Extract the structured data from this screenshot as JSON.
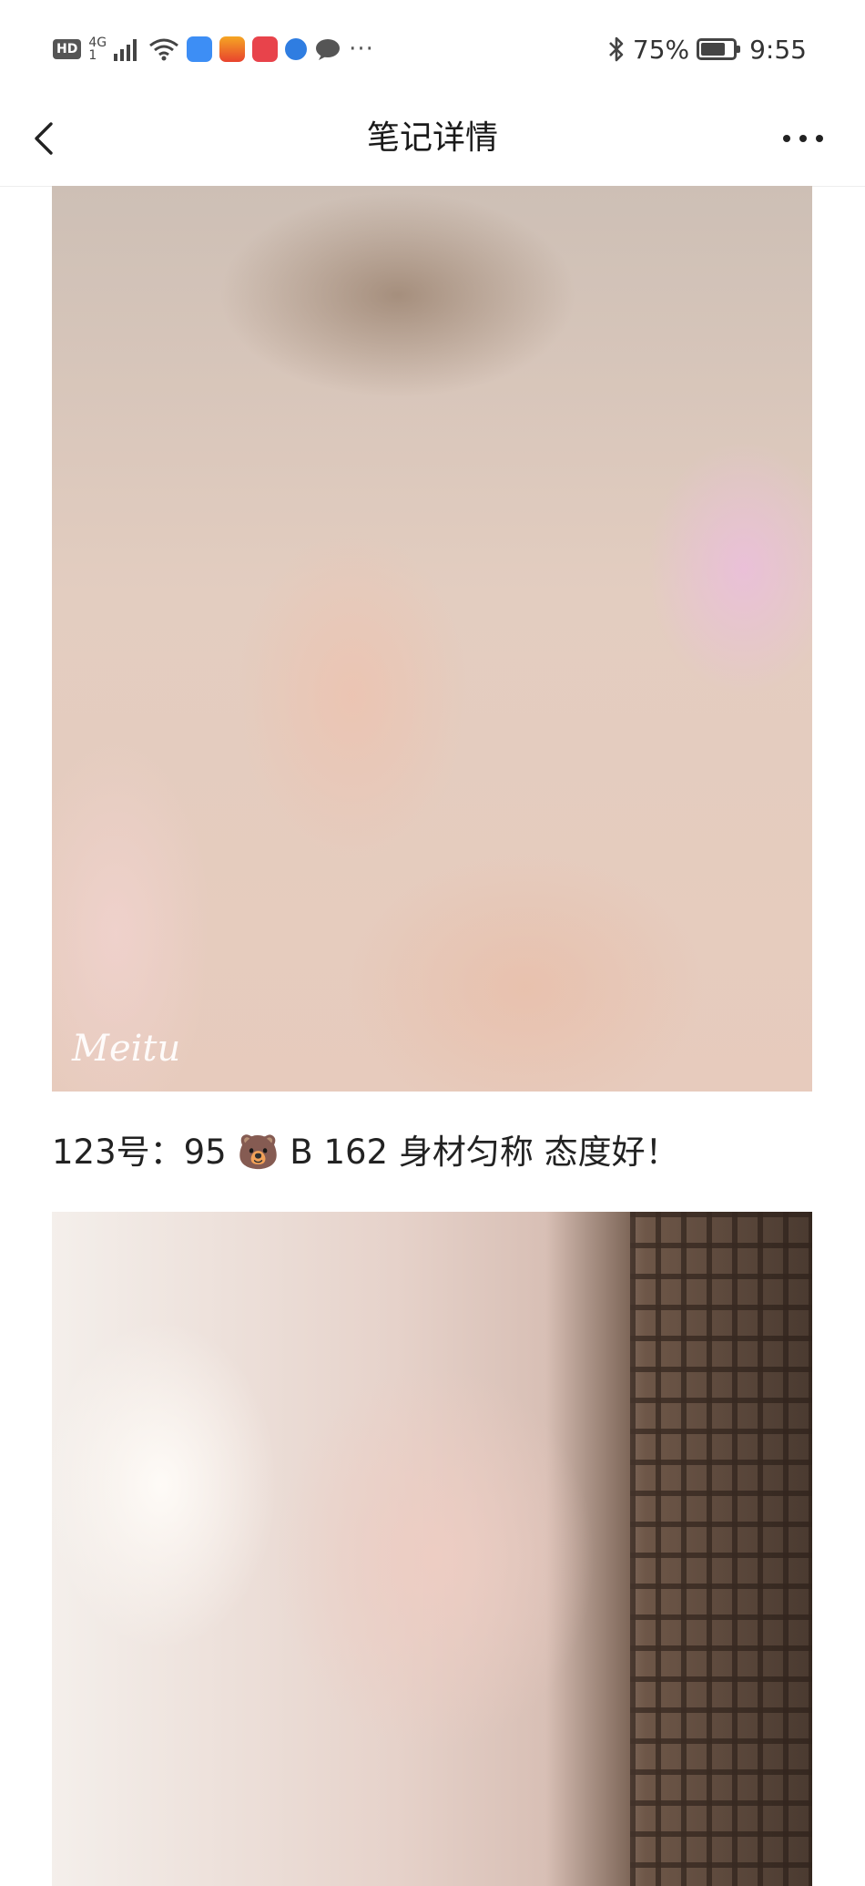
{
  "status_bar": {
    "hd": "HD",
    "network": "4G",
    "network_sub": "1",
    "more": "···",
    "battery_percent": "75%",
    "battery_level": 0.75,
    "time": "9:55",
    "icons": [
      "signal-icon",
      "wifi-icon",
      "bluetooth-icon"
    ]
  },
  "header": {
    "title": "笔记详情",
    "back_icon": "chevron-left-icon",
    "more_icon": "more-horizontal-icon"
  },
  "content": {
    "photo_1_watermark": "Meitu",
    "caption": "123号：95 🐻 B   162    身材匀称    态度好！"
  },
  "colors": {
    "background": "#ffffff",
    "text": "#222222",
    "divider": "#ededed"
  }
}
